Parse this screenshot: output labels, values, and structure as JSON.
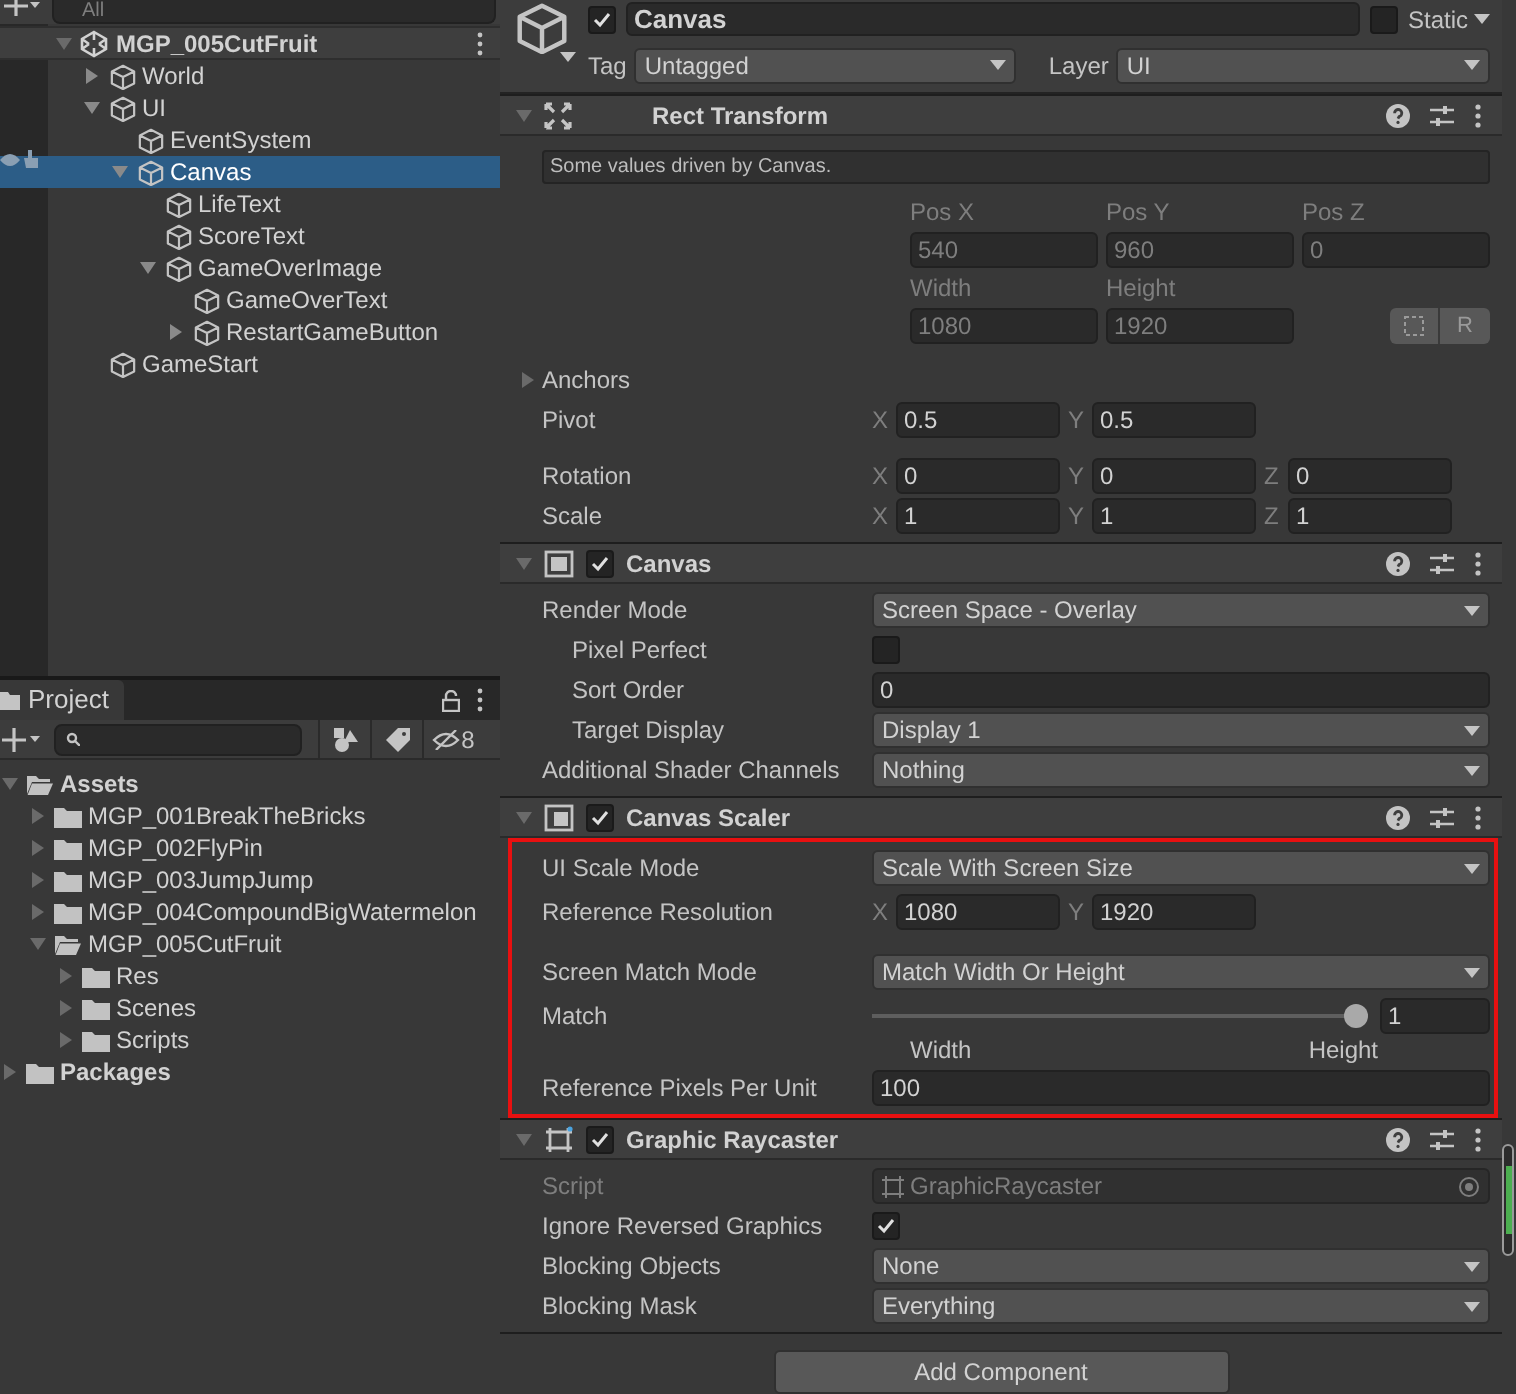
{
  "hierarchy": {
    "search_placeholder": "All",
    "scene": "MGP_005CutFruit",
    "items": [
      {
        "name": "World",
        "expandable": true,
        "expanded": false,
        "selected": false
      },
      {
        "name": "UI",
        "expandable": true,
        "expanded": true,
        "selected": false,
        "children": [
          {
            "name": "EventSystem",
            "expandable": false,
            "selected": false
          },
          {
            "name": "Canvas",
            "expandable": true,
            "expanded": true,
            "selected": true,
            "children": [
              {
                "name": "LifeText",
                "expandable": false,
                "selected": false
              },
              {
                "name": "ScoreText",
                "expandable": false,
                "selected": false
              },
              {
                "name": "GameOverImage",
                "expandable": true,
                "expanded": true,
                "selected": false,
                "children": [
                  {
                    "name": "GameOverText",
                    "expandable": false,
                    "selected": false
                  },
                  {
                    "name": "RestartGameButton",
                    "expandable": true,
                    "expanded": false,
                    "selected": false
                  }
                ]
              }
            ]
          }
        ]
      },
      {
        "name": "GameStart",
        "expandable": false,
        "selected": false
      }
    ]
  },
  "project": {
    "tab": "Project",
    "hidden_count": "8",
    "items": [
      {
        "name": "Assets",
        "expanded": true,
        "bold": true,
        "selected": false,
        "children": [
          {
            "name": "MGP_001BreakTheBricks",
            "expanded": false,
            "bold": false,
            "selected": false
          },
          {
            "name": "MGP_002FlyPin",
            "expanded": false,
            "bold": false,
            "selected": false
          },
          {
            "name": "MGP_003JumpJump",
            "expanded": false,
            "bold": false,
            "selected": false
          },
          {
            "name": "MGP_004CompoundBigWatermelon",
            "expanded": false,
            "bold": false,
            "selected": false
          },
          {
            "name": "MGP_005CutFruit",
            "expanded": true,
            "bold": false,
            "selected": false,
            "children": [
              {
                "name": "Res",
                "expanded": false,
                "bold": false,
                "selected": false
              },
              {
                "name": "Scenes",
                "expanded": false,
                "bold": false,
                "selected": false
              },
              {
                "name": "Scripts",
                "expanded": false,
                "bold": false,
                "selected": false
              }
            ]
          }
        ]
      },
      {
        "name": "Packages",
        "expanded": false,
        "bold": true,
        "selected": false
      }
    ]
  },
  "inspector": {
    "active": true,
    "name": "Canvas",
    "static": false,
    "static_label": "Static",
    "tag_label": "Tag",
    "tag": "Untagged",
    "layer_label": "Layer",
    "layer": "UI",
    "components": [
      {
        "title": "Rect Transform",
        "highlighted": false,
        "rows": [
          {
            "kind": "note",
            "text": "Some values driven by Canvas."
          },
          {
            "kind": "stacked",
            "disabled": true,
            "fields": [
              {
                "label": "Pos X",
                "value": "540"
              },
              {
                "label": "Pos Y",
                "value": "960"
              },
              {
                "label": "Pos Z",
                "value": "0"
              }
            ]
          },
          {
            "kind": "stacked",
            "disabled": true,
            "fields": [
              {
                "label": "Width",
                "value": "1080"
              },
              {
                "label": "Height",
                "value": "1920"
              }
            ],
            "button": "R"
          },
          {
            "kind": "foldout",
            "label": "Anchors",
            "expanded": false
          },
          {
            "kind": "vector",
            "label": "Pivot",
            "fields": [
              {
                "axis": "X",
                "value": "0.5"
              },
              {
                "axis": "Y",
                "value": "0.5"
              }
            ]
          },
          {
            "kind": "vector",
            "label": "Rotation",
            "fields": [
              {
                "axis": "X",
                "value": "0"
              },
              {
                "axis": "Y",
                "value": "0"
              },
              {
                "axis": "Z",
                "value": "0"
              }
            ]
          },
          {
            "kind": "vector",
            "label": "Scale",
            "fields": [
              {
                "axis": "X",
                "value": "1"
              },
              {
                "axis": "Y",
                "value": "1"
              },
              {
                "axis": "Z",
                "value": "1"
              }
            ]
          }
        ]
      },
      {
        "title": "Canvas",
        "enabled": true,
        "highlighted": false,
        "rows": [
          {
            "kind": "dropdown",
            "label": "Render Mode",
            "value": "Screen Space - Overlay",
            "children": [
              {
                "kind": "checkbox",
                "label": "Pixel Perfect",
                "checked": false
              },
              {
                "kind": "number",
                "label": "Sort Order",
                "value": "0"
              },
              {
                "kind": "dropdown",
                "label": "Target Display",
                "value": "Display 1"
              }
            ]
          },
          {
            "kind": "dropdown",
            "label": "Additional Shader Channels",
            "value": "Nothing"
          }
        ]
      },
      {
        "title": "Canvas Scaler",
        "enabled": true,
        "highlighted": true,
        "rows": [
          {
            "kind": "dropdown",
            "label": "UI Scale Mode",
            "value": "Scale With Screen Size"
          },
          {
            "kind": "vector",
            "label": "Reference Resolution",
            "fields": [
              {
                "axis": "X",
                "value": "1080"
              },
              {
                "axis": "Y",
                "value": "1920"
              }
            ]
          },
          {
            "kind": "dropdown",
            "label": "Screen Match Mode",
            "value": "Match Width Or Height"
          },
          {
            "kind": "slider",
            "label": "Match",
            "level": 1,
            "value": "1",
            "min_label": "Width",
            "max_label": "Height"
          },
          {
            "kind": "number",
            "label": "Reference Pixels Per Unit",
            "value": "100"
          }
        ]
      },
      {
        "title": "Graphic Raycaster",
        "enabled": true,
        "highlighted": false,
        "rows": [
          {
            "kind": "object",
            "label": "Script",
            "value": "GraphicRaycaster",
            "disabled": true
          },
          {
            "kind": "checkbox",
            "label": "Ignore Reversed Graphics",
            "checked": true
          },
          {
            "kind": "dropdown",
            "label": "Blocking Objects",
            "value": "None"
          },
          {
            "kind": "dropdown",
            "label": "Blocking Mask",
            "value": "Everything"
          }
        ]
      }
    ],
    "add_button": "Add Component"
  }
}
